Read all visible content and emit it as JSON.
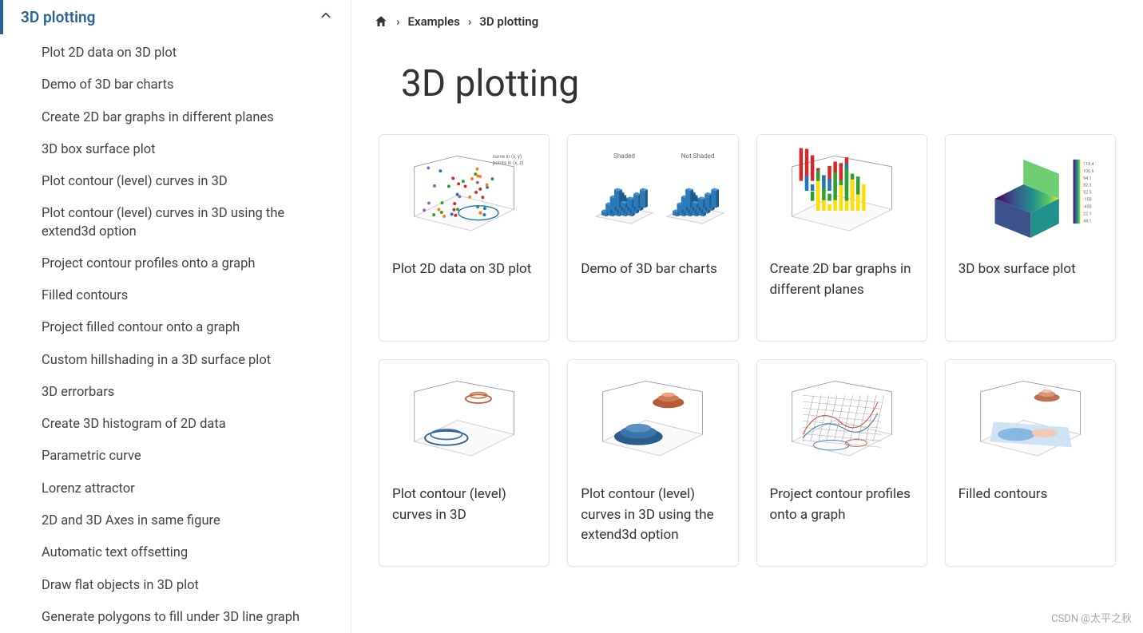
{
  "sidebar": {
    "section_title": "3D plotting",
    "items": [
      "Plot 2D data on 3D plot",
      "Demo of 3D bar charts",
      "Create 2D bar graphs in different planes",
      "3D box surface plot",
      "Plot contour (level) curves in 3D",
      "Plot contour (level) curves in 3D using the extend3d option",
      "Project contour profiles onto a graph",
      "Filled contours",
      "Project filled contour onto a graph",
      "Custom hillshading in a 3D surface plot",
      "3D errorbars",
      "Create 3D histogram of 2D data",
      "Parametric curve",
      "Lorenz attractor",
      "2D and 3D Axes in same figure",
      "Automatic text offsetting",
      "Draw flat objects in 3D plot",
      "Generate polygons to fill under 3D line graph"
    ]
  },
  "breadcrumb": {
    "home_label": "Home",
    "items": [
      "Examples",
      "3D plotting"
    ]
  },
  "page": {
    "title": "3D plotting"
  },
  "gallery": [
    {
      "title": "Plot 2D data on 3D plot",
      "thumb": "scatter3d"
    },
    {
      "title": "Demo of 3D bar charts",
      "thumb": "bar3d-pair"
    },
    {
      "title": "Create 2D bar graphs in different planes",
      "thumb": "bars-planes"
    },
    {
      "title": "3D box surface plot",
      "thumb": "box-surface"
    },
    {
      "title": "Plot contour (level) curves in 3D",
      "thumb": "contour3d-a"
    },
    {
      "title": "Plot contour (level) curves in 3D using the extend3d option",
      "thumb": "contour3d-b"
    },
    {
      "title": "Project contour profiles onto a graph",
      "thumb": "contour-profiles"
    },
    {
      "title": "Filled contours",
      "thumb": "filled-contours"
    }
  ],
  "watermark": "CSDN @太平之秋"
}
